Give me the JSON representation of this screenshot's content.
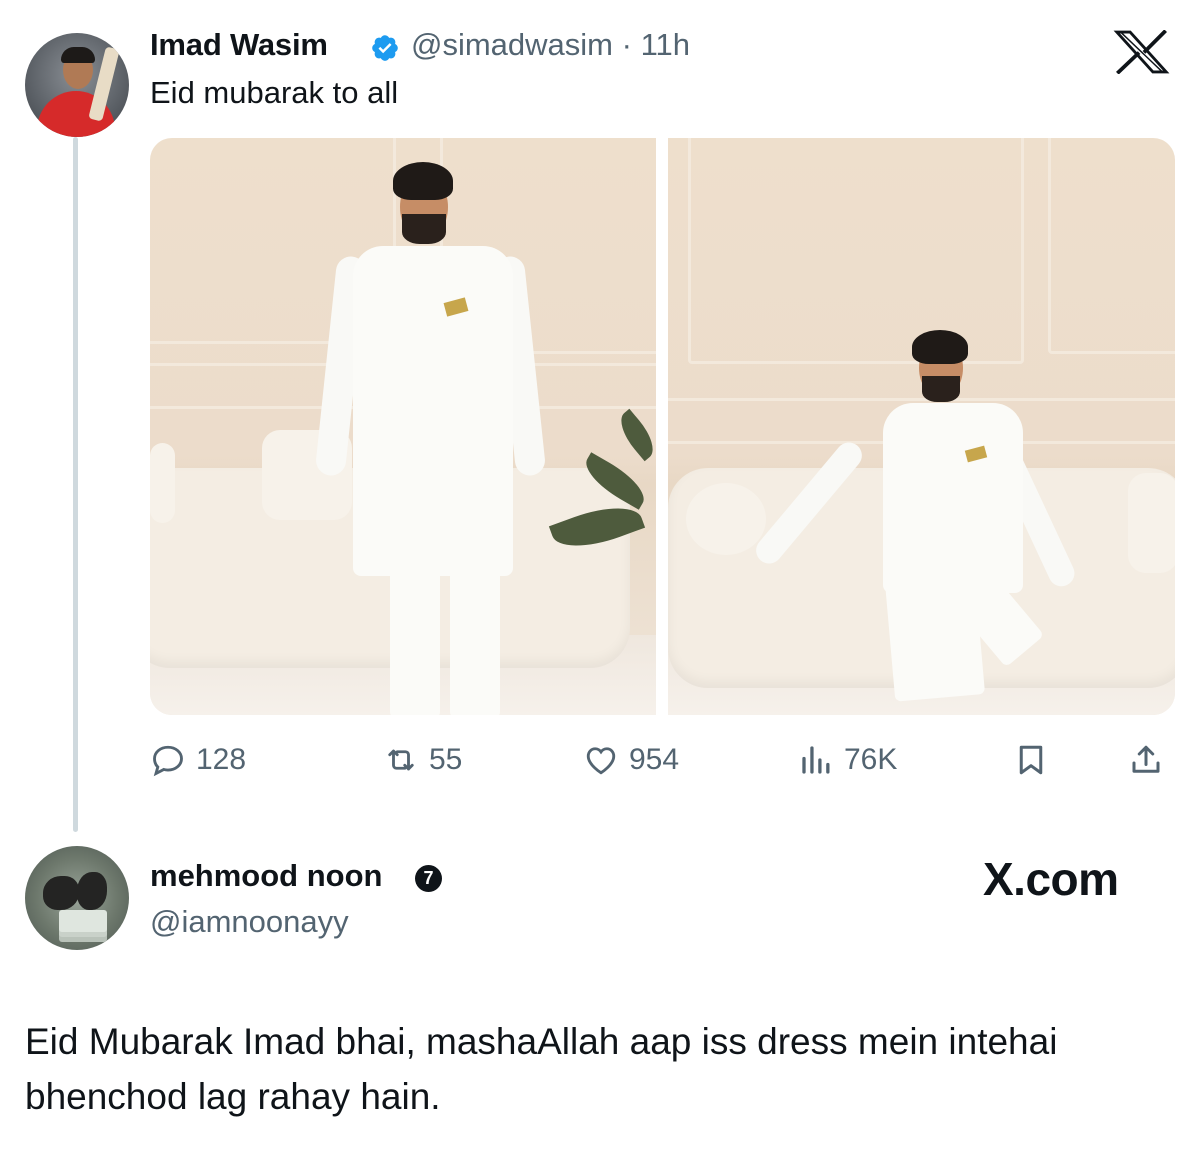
{
  "tweet1": {
    "name": "Imad Wasim",
    "handle": "@simadwasim",
    "separator": "·",
    "time": "11h",
    "text": "Eid mubarak to all",
    "verified_color": "#1d9bf0",
    "actions": {
      "replies": "128",
      "reposts": "55",
      "likes": "954",
      "views": "76K"
    }
  },
  "tweet2": {
    "name": "mehmood noon",
    "badge": "7",
    "handle": "@iamnoonayy",
    "watermark": "X.com",
    "text": "Eid Mubarak Imad bhai, mashaAllah aap iss dress mein intehai bhenchod lag rahay hain."
  },
  "icons": {
    "brand": "x-logo-icon",
    "reply": "reply-icon",
    "repost": "repost-icon",
    "like": "heart-icon",
    "views": "views-icon",
    "bookmark": "bookmark-icon",
    "share": "share-icon"
  },
  "colors": {
    "text": "#0f1419",
    "secondary": "#536471",
    "thread_line": "#cfd9de"
  }
}
